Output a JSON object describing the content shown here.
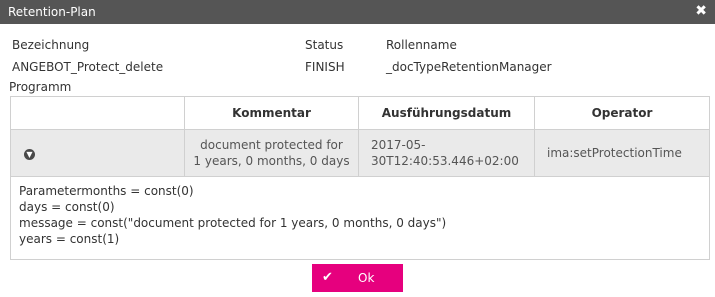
{
  "dialog": {
    "title": "Retention-Plan",
    "close_icon": "close-icon"
  },
  "info": {
    "label_bezeichnung": "Bezeichnung",
    "value_bezeichnung": "ANGEBOT_Protect_delete",
    "label_status": "Status",
    "value_status": "FINISH",
    "label_rollenname": "Rollenname",
    "value_rollenname": "_docTypeRetentionManager",
    "label_programm": "Programm"
  },
  "table": {
    "headers": [
      "",
      "Kommentar",
      "Ausführungsdatum",
      "Operator"
    ],
    "row": {
      "expand_icon": "chevron-down-circle-icon",
      "kommentar_line1": "document protected for",
      "kommentar_line2": "1 years, 0 months, 0 days",
      "datum_line1": "2017-05-",
      "datum_line2": "30T12:40:53.446+02:00",
      "operator": "ima:setProtectionTime"
    },
    "parameters": [
      "Parametermonths = const(0)",
      "days = const(0)",
      "message = const(\"document protected for 1 years, 0 months, 0 days\")",
      "years = const(1)"
    ]
  },
  "footer": {
    "ok_label": "Ok",
    "ok_icon": "check-icon"
  },
  "colors": {
    "titlebar": "#555555",
    "accent": "#e6007e",
    "row_background": "#eaeaea"
  }
}
